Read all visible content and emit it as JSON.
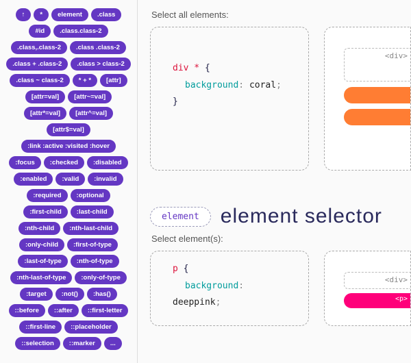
{
  "sidebar": {
    "pills": [
      "↑",
      "*",
      "element",
      ".class",
      "#id",
      ".class.class-2",
      ".class,.class-2",
      ".class .class-2",
      ".class + .class-2",
      ".class > class-2",
      ".class ~ class-2",
      "* + *",
      "[attr]",
      "[attr=val]",
      "[attr~=val]",
      "[attr*=val]",
      "[attr^=val]",
      "[attr$=val]",
      ":link :active :visited :hover",
      ":focus",
      ":checked",
      ":disabled",
      ":enabled",
      ":valid",
      ":invalid",
      ":required",
      ":optional",
      ":first-child",
      ":last-child",
      ":nth-child",
      ":nth-last-child",
      ":only-child",
      ":first-of-type",
      ":last-of-type",
      ":nth-of-type",
      ":nth-last-of-type",
      ":only-of-type",
      ":target",
      ":not()",
      ":has()",
      "::before",
      "::after",
      "::first-letter",
      "::first-line",
      "::placeholder",
      "::selection",
      "::marker",
      "..."
    ]
  },
  "block1": {
    "label": "Select all elements:",
    "code_sel": "div *",
    "code_prop": "background",
    "code_val": "coral",
    "demo_tag": "<div>"
  },
  "heading": {
    "tag": "element",
    "title": "element selector"
  },
  "block2": {
    "label": "Select element(s):",
    "code_sel": "p",
    "code_prop": "background",
    "code_val": "deeppink",
    "demo_tag": "<div>",
    "demo_el": "<p>"
  }
}
